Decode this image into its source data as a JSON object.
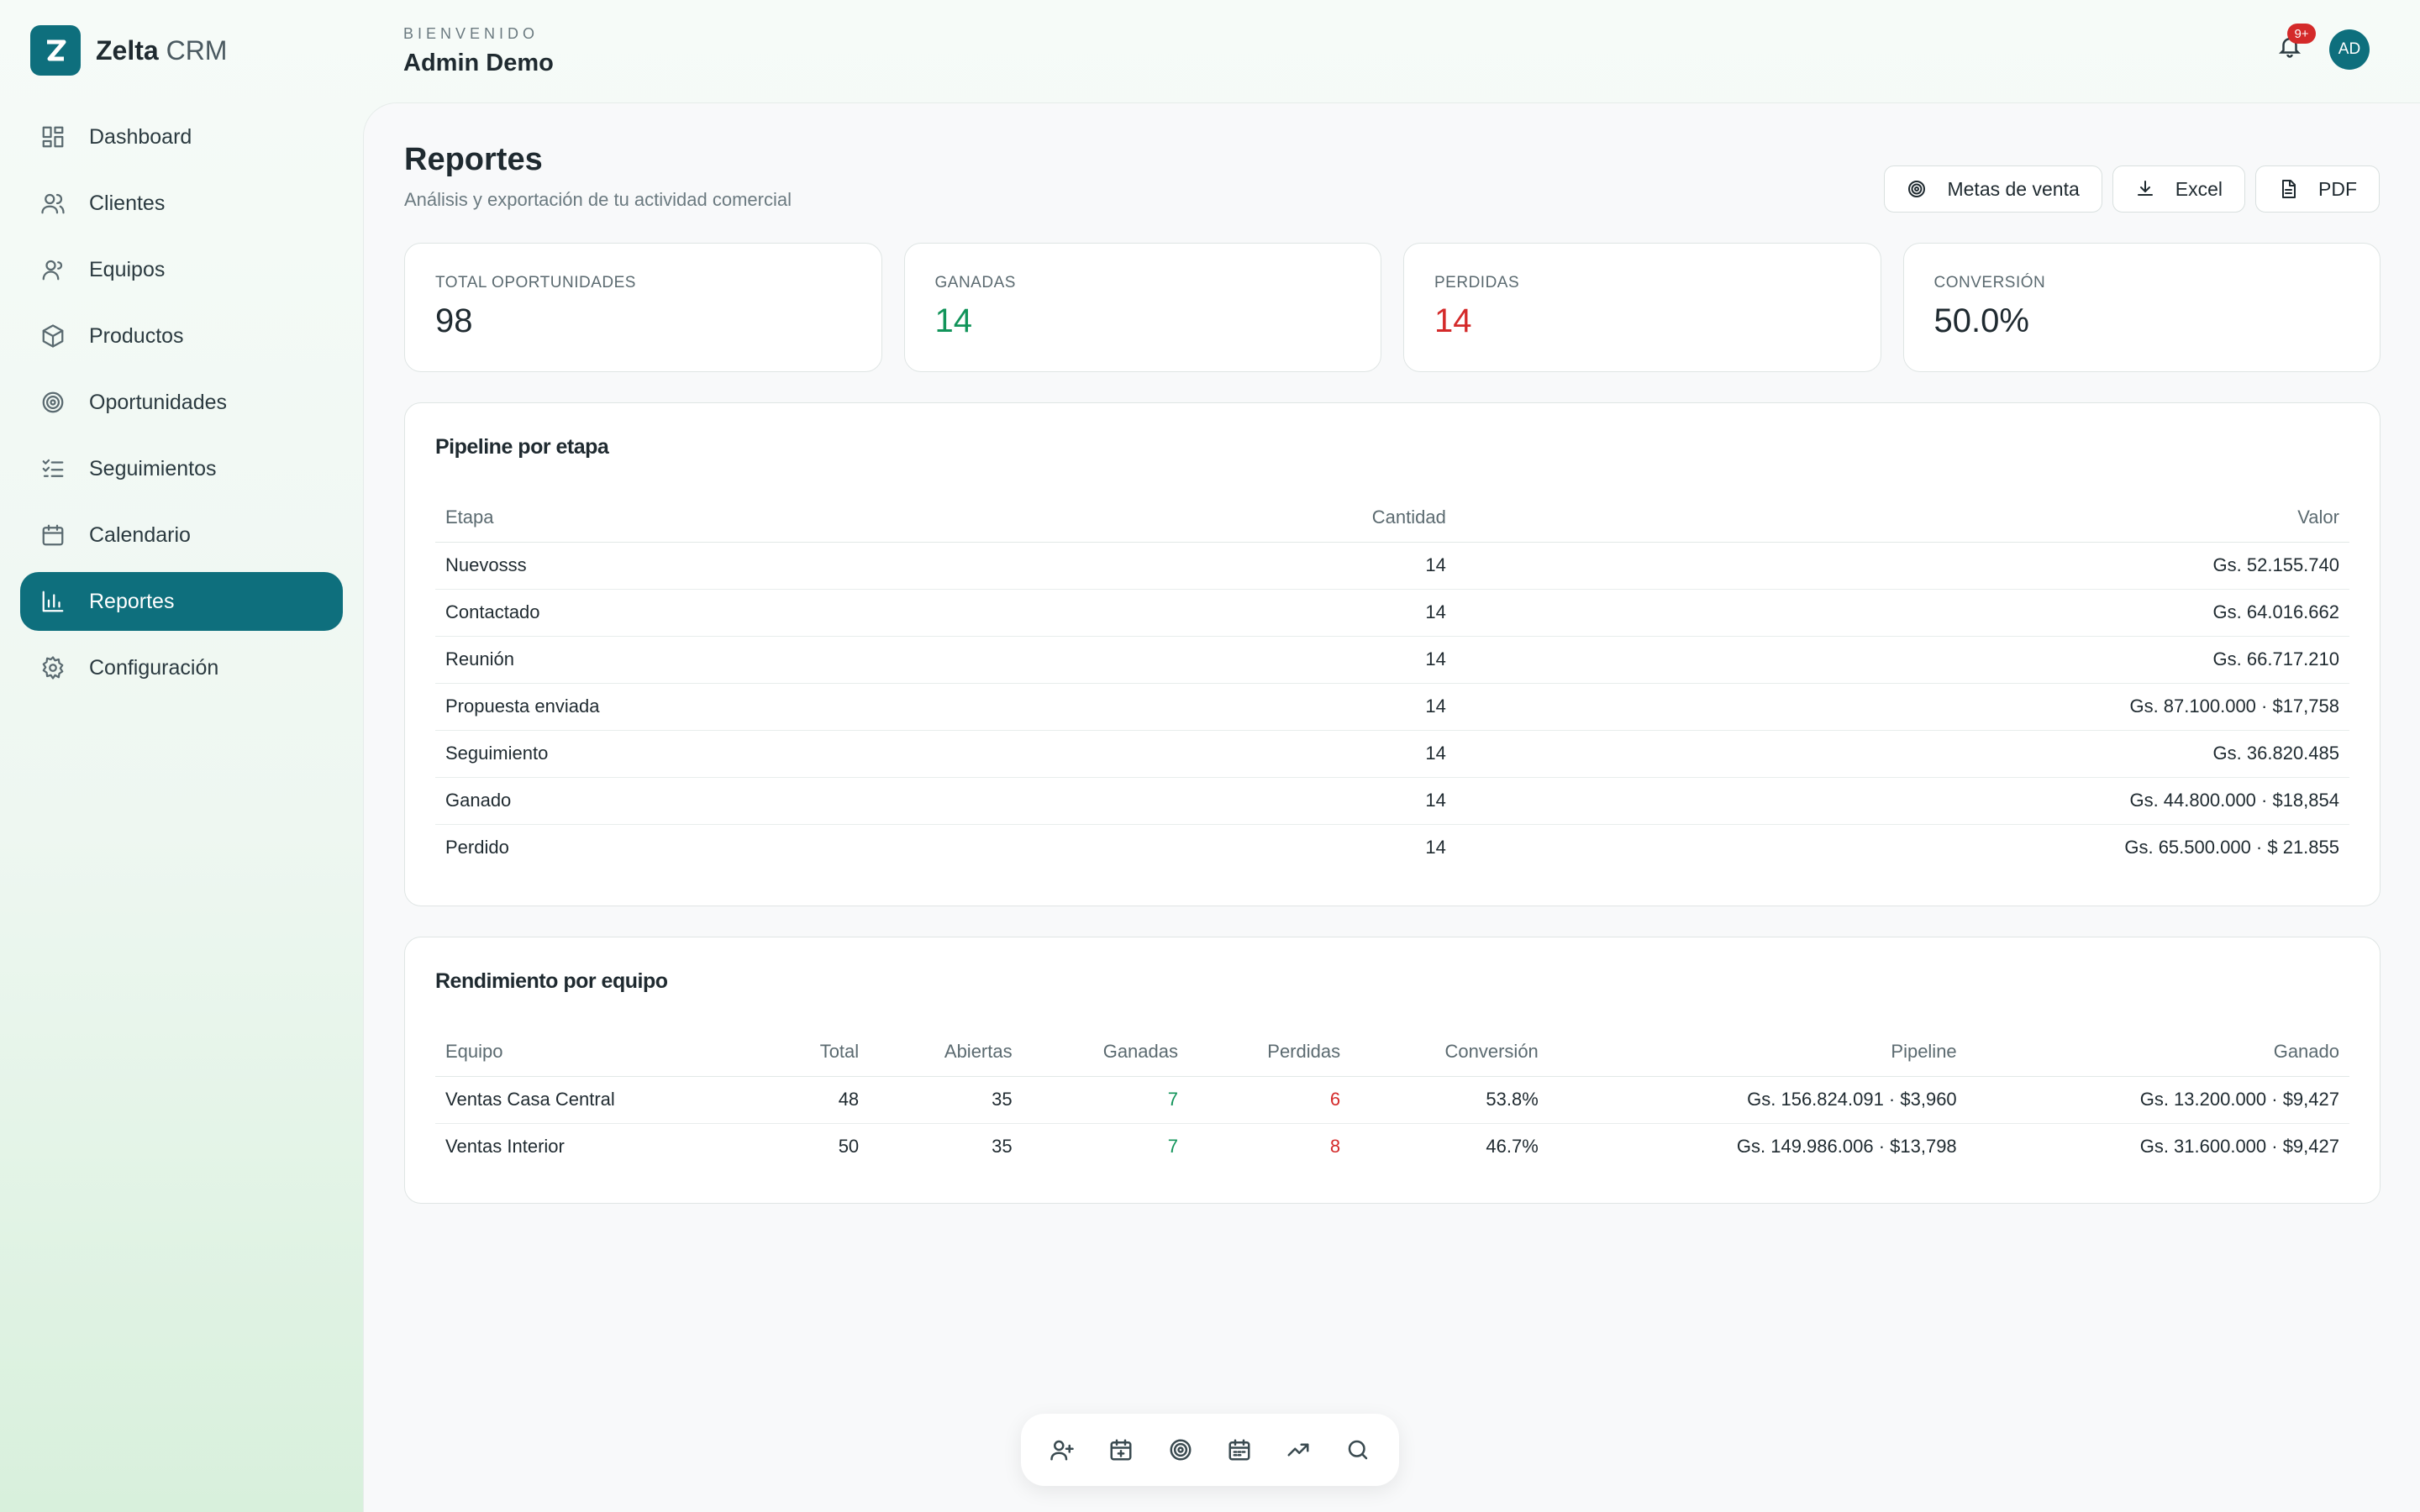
{
  "brand": {
    "name_main": "Zelta",
    "name_sub": " CRM",
    "logo_letter": "Z"
  },
  "sidebar": {
    "items": [
      {
        "label": "Dashboard",
        "icon": "layout-icon",
        "active": false
      },
      {
        "label": "Clientes",
        "icon": "users-icon",
        "active": false
      },
      {
        "label": "Equipos",
        "icon": "team-icon",
        "active": false
      },
      {
        "label": "Productos",
        "icon": "box-icon",
        "active": false
      },
      {
        "label": "Oportunidades",
        "icon": "target-icon",
        "active": false
      },
      {
        "label": "Seguimientos",
        "icon": "checklist-icon",
        "active": false
      },
      {
        "label": "Calendario",
        "icon": "calendar-icon",
        "active": false
      },
      {
        "label": "Reportes",
        "icon": "bar-chart-icon",
        "active": true
      },
      {
        "label": "Configuración",
        "icon": "gear-icon",
        "active": false
      }
    ]
  },
  "header": {
    "kicker": "BIENVENIDO",
    "user_name": "Admin Demo",
    "notifications_badge": "9+",
    "avatar_initials": "AD"
  },
  "page": {
    "title": "Reportes",
    "subtitle": "Análisis y exportación de tu actividad comercial",
    "actions": {
      "goals": "Metas de venta",
      "excel": "Excel",
      "pdf": "PDF"
    }
  },
  "kpis": [
    {
      "label": "TOTAL OPORTUNIDADES",
      "value": "98",
      "tone": "neutral"
    },
    {
      "label": "GANADAS",
      "value": "14",
      "tone": "green"
    },
    {
      "label": "PERDIDAS",
      "value": "14",
      "tone": "red"
    },
    {
      "label": "CONVERSIÓN",
      "value": "50.0%",
      "tone": "neutral"
    }
  ],
  "pipeline": {
    "title": "Pipeline por etapa",
    "headers": {
      "stage": "Etapa",
      "count": "Cantidad",
      "value": "Valor"
    },
    "rows": [
      {
        "stage": "Nuevosss",
        "count": "14",
        "value": "Gs. 52.155.740"
      },
      {
        "stage": "Contactado",
        "count": "14",
        "value": "Gs. 64.016.662"
      },
      {
        "stage": "Reunión",
        "count": "14",
        "value": "Gs. 66.717.210"
      },
      {
        "stage": "Propuesta enviada",
        "count": "14",
        "value": "Gs. 87.100.000 · $17,758"
      },
      {
        "stage": "Seguimiento",
        "count": "14",
        "value": "Gs. 36.820.485"
      },
      {
        "stage": "Ganado",
        "count": "14",
        "value": "Gs. 44.800.000 · $18,854"
      },
      {
        "stage": "Perdido",
        "count": "14",
        "value": "Gs. 65.500.000 · $ 21.855"
      }
    ]
  },
  "teams": {
    "title": "Rendimiento por equipo",
    "headers": {
      "team": "Equipo",
      "total": "Total",
      "open": "Abiertas",
      "won": "Ganadas",
      "lost": "Perdidas",
      "conversion": "Conversión",
      "pipeline": "Pipeline",
      "won_value": "Ganado"
    },
    "rows": [
      {
        "team": "Ventas Casa Central",
        "total": "48",
        "open": "35",
        "won": "7",
        "lost": "6",
        "conversion": "53.8%",
        "pipeline": "Gs. 156.824.091 · $3,960",
        "won_value": "Gs. 13.200.000 · $9,427"
      },
      {
        "team": "Ventas Interior",
        "total": "50",
        "open": "35",
        "won": "7",
        "lost": "8",
        "conversion": "46.7%",
        "pipeline": "Gs. 149.986.006 · $13,798",
        "won_value": "Gs. 31.600.000 · $9,427"
      }
    ]
  },
  "dock": {
    "items": [
      "add-user-icon",
      "calendar-plus-icon",
      "target-icon",
      "calendar-icon",
      "trending-up-icon",
      "search-icon"
    ]
  },
  "colors": {
    "accent": "#0e6f7d",
    "positive": "#12945a",
    "negative": "#d42a2a"
  }
}
